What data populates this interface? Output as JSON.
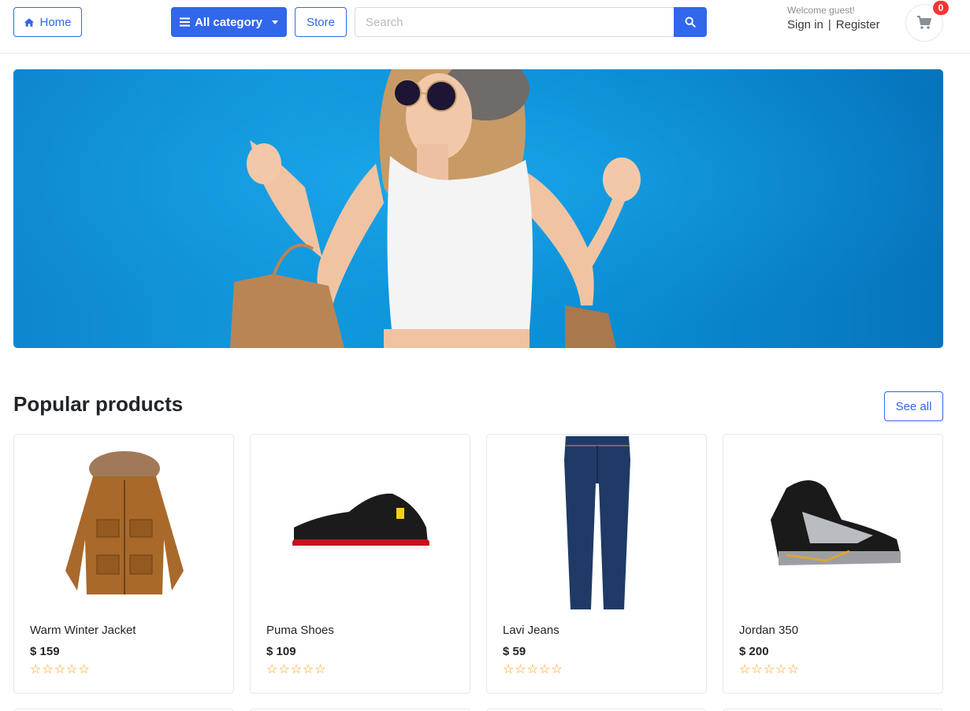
{
  "header": {
    "home_label": "Home",
    "category_label": "All category",
    "store_label": "Store",
    "search_placeholder": "Search",
    "welcome_text": "Welcome guest!",
    "signin_label": "Sign in",
    "register_label": "Register",
    "cart_count": "0"
  },
  "section": {
    "title": "Popular products",
    "see_all_label": "See all"
  },
  "products": [
    {
      "name": "Warm Winter Jacket",
      "price": "$ 159",
      "rating": 0,
      "stars": "☆☆☆☆☆"
    },
    {
      "name": "Puma Shoes",
      "price": "$ 109",
      "rating": 0,
      "stars": "☆☆☆☆☆"
    },
    {
      "name": "Lavi Jeans",
      "price": "$ 59",
      "rating": 0,
      "stars": "☆☆☆☆☆"
    },
    {
      "name": "Jordan 350",
      "price": "$ 200",
      "rating": 0,
      "stars": "☆☆☆☆☆"
    }
  ],
  "colors": {
    "primary": "#3167eb",
    "badge": "#fa3434",
    "star": "#ff9800"
  },
  "icons": {
    "home": "home-icon",
    "category": "bars-icon",
    "search": "search-icon",
    "cart": "shopping-cart-icon"
  }
}
